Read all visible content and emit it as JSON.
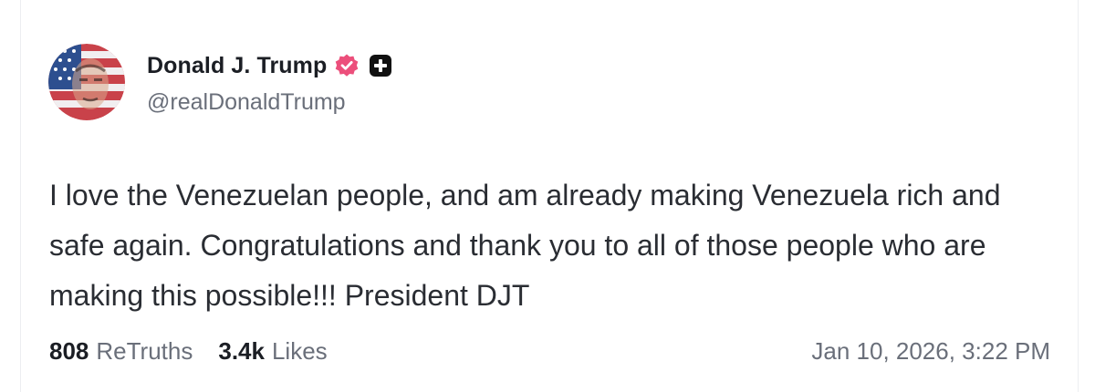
{
  "author": {
    "display_name": "Donald J. Trump",
    "handle": "@realDonaldTrump",
    "verified_badge_color": "#ec4f7b"
  },
  "post": {
    "text": "I love the Venezuelan people, and am already making Venezuela rich and safe again. Congratulations and thank you to all of those people who are making this possible!!! President DJT",
    "retruths_count": "808",
    "retruths_label": "ReTruths",
    "likes_count": "3.4k",
    "likes_label": "Likes",
    "timestamp": "Jan 10, 2026, 3:22 PM"
  },
  "icons": {
    "verified": "verified-check-icon",
    "plus": "plus-badge-icon"
  }
}
